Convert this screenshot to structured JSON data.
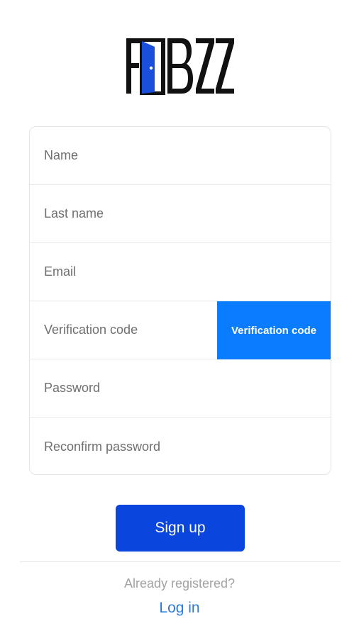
{
  "brand": {
    "logo_text": "FOBZZ",
    "door_color": "#1a4fdc"
  },
  "form": {
    "fields": [
      {
        "placeholder": "Name"
      },
      {
        "placeholder": "Last name"
      },
      {
        "placeholder": "Email"
      },
      {
        "placeholder": "Verification code"
      },
      {
        "placeholder": "Password"
      },
      {
        "placeholder": "Reconfirm password"
      }
    ],
    "verify_button_label": "Verification code"
  },
  "actions": {
    "signup_label": "Sign up",
    "already_registered": "Already registered?",
    "login_label": "Log in"
  },
  "colors": {
    "accent": "#0a7cff",
    "primary_button": "#0a45de",
    "link": "#2a7be0"
  }
}
